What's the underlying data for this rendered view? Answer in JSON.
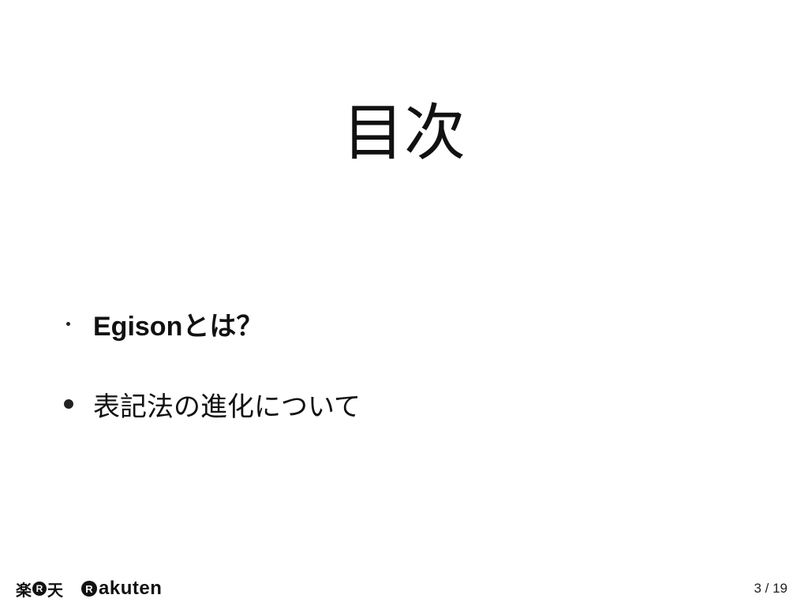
{
  "slide": {
    "title": "目次"
  },
  "bullets": [
    {
      "text": "Egisonとは？",
      "bold": true,
      "bullet_style": "small"
    },
    {
      "text": "表記法の進化について",
      "bold": false,
      "bullet_style": "large"
    }
  ],
  "footer": {
    "logo_kanji_left": "楽",
    "logo_kanji_r": "R",
    "logo_kanji_right": "天",
    "logo_en_r": "R",
    "logo_en_text": "akuten",
    "page_current": "3",
    "page_separator": " / ",
    "page_total": "19"
  }
}
